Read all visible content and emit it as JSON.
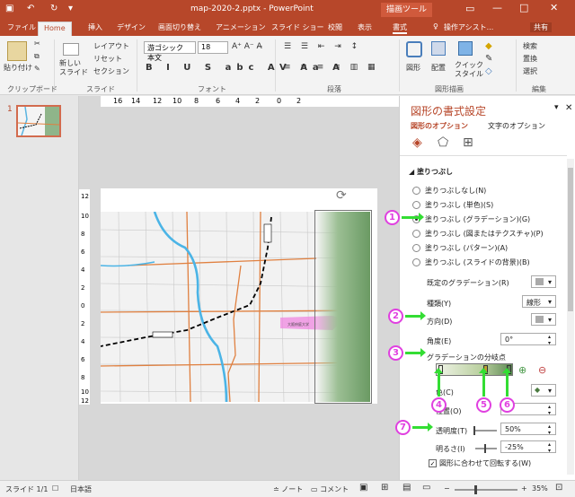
{
  "window": {
    "title": "map-2020-2.pptx - PowerPoint",
    "context_tab": "描画ツール",
    "user": "共有"
  },
  "tabs": [
    "ファイル",
    "Home",
    "挿入",
    "デザイン",
    "画面切り替え",
    "アニメーション",
    "スライド ショー",
    "校閲",
    "表示",
    "書式"
  ],
  "tell_me": "操作アシスト...",
  "ribbon": {
    "paste": "貼り付け",
    "new_slide": "新しい\nスライド",
    "layout": "レイアウト",
    "reset": "リセット",
    "section": "セクション",
    "font_name": "游ゴシック 本文",
    "font_size": "18",
    "groups": {
      "clipboard": "クリップボード",
      "slides": "スライド",
      "font": "フォント",
      "paragraph": "段落",
      "drawing": "図形描画",
      "editing": "編集"
    },
    "shapes": "図形",
    "arrange": "配置",
    "quick_style": "クイック\nスタイル",
    "search": "検索",
    "replace": "置換",
    "select": "選択"
  },
  "ruler": [
    "16",
    "14",
    "12",
    "10",
    "8",
    "6",
    "4",
    "2",
    "0",
    "2"
  ],
  "vruler": [
    "12",
    "10",
    "8",
    "6",
    "4",
    "2",
    "0",
    "2",
    "4",
    "6",
    "8",
    "10",
    "12"
  ],
  "slide": {
    "number": "1",
    "map_label": "大阪府庭大学"
  },
  "format_pane": {
    "title": "図形の書式設定",
    "tab_shape": "図形のオプション",
    "tab_text": "文字のオプション",
    "section": "塗りつぶし",
    "fill_options": [
      "塗りつぶしなし(N)",
      "塗りつぶし (単色)(S)",
      "塗りつぶし (グラデーション)(G)",
      "塗りつぶし (図またはテクスチャ)(P)",
      "塗りつぶし (パターン)(A)",
      "塗りつぶし (スライドの背景)(B)"
    ],
    "preset_label": "既定のグラデーション(R)",
    "type_label": "種類(Y)",
    "type_value": "線形",
    "direction_label": "方向(D)",
    "angle_label": "角度(E)",
    "angle_value": "0°",
    "stops_label": "グラデーションの分岐点",
    "color_label": "色(C)",
    "position_label": "位置(O)",
    "position_value": "%",
    "transparency_label": "透明度(T)",
    "transparency_value": "50%",
    "brightness_label": "明るさ(I)",
    "brightness_value": "-25%",
    "rotate_label": "図形に合わせて回転する(W)"
  },
  "callouts": [
    "1",
    "2",
    "3",
    "4",
    "5",
    "6",
    "7"
  ],
  "status": {
    "slide": "スライド 1/1",
    "language": "日本語",
    "notes": "ノート",
    "comments": "コメント",
    "zoom": "35%"
  },
  "colors": {
    "brand": "#b7472a",
    "callout": "#e040e0",
    "arrow": "#33dd33"
  }
}
